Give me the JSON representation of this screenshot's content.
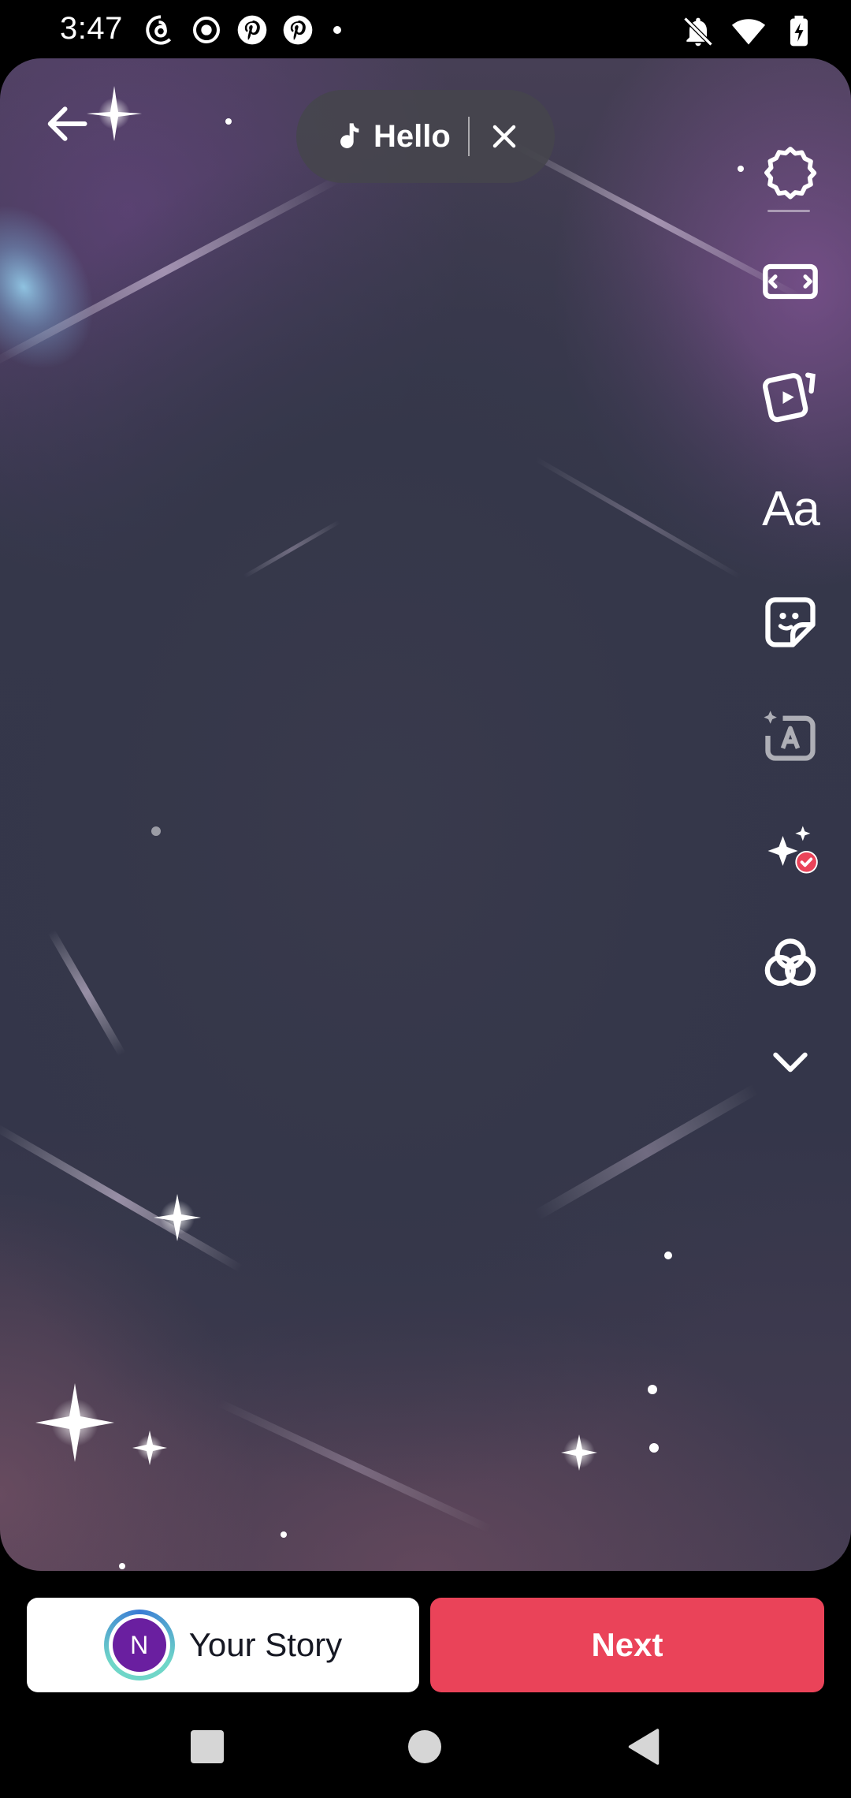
{
  "status_bar": {
    "time": "3:47"
  },
  "music": {
    "title": "Hello"
  },
  "toolbar": {
    "text_tool_label": "Aa"
  },
  "bottom": {
    "avatar_letter": "N",
    "story_label": "Your Story",
    "next_label": "Next"
  },
  "colors": {
    "next_button": "#ea4359",
    "avatar_bg": "#6a1fa0",
    "check_badge": "#ea4359"
  }
}
